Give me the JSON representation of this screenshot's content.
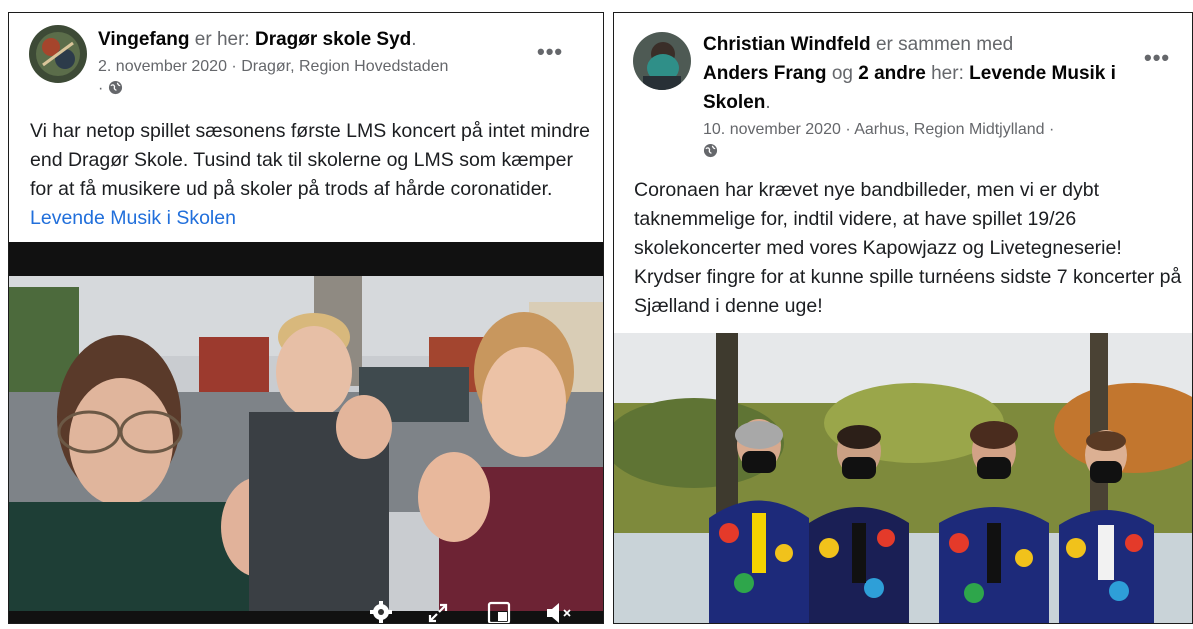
{
  "left_post": {
    "author": "Vingefang",
    "connector": "er her:",
    "place": "Dragør skole Syd",
    "place_suffix": ".",
    "date_location": "2. november 2020 · Dragør, Region Hovedstaden",
    "meta_sep": "·",
    "text": "Vi har netop spillet sæsonens første LMS koncert på intet mindre end Dragør Skole. Tusind tak til skolerne og LMS som kæmper for at få musikere ud på skoler på trods af hårde coronatider.",
    "link_text": "Levende Musik i Skolen",
    "more_label": "•••",
    "video_controls": [
      "settings-icon",
      "expand-icon",
      "miniplayer-icon",
      "volume-muted-icon"
    ]
  },
  "right_post": {
    "author": "Christian Windfeld",
    "connector": "er sammen med",
    "tagged": "Anders Frang",
    "and": "og",
    "others": "2 andre",
    "here": "her:",
    "place": "Levende Musik i Skolen",
    "place_suffix": ".",
    "date_location": "10. november 2020 · Aarhus, Region Midtjylland ·",
    "text": "Coronaen har krævet nye bandbilleder, men vi er dybt taknemmelige for, indtil videre, at have spillet 19/26 skolekoncerter med vores Kapowjazz og Livetegneserie! Krydser fingre for at kunne spille turnéens sidste 7 koncerter på Sjælland i denne uge!",
    "more_label": "•••"
  },
  "colors": {
    "link": "#216fdb",
    "meta_gray": "#65676b",
    "video_bar": "#111111"
  }
}
